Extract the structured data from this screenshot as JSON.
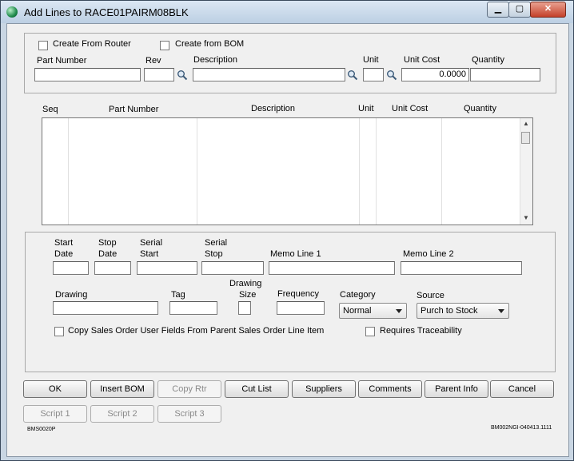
{
  "window": {
    "title": "Add Lines to RACE01PAIRM08BLK",
    "min_glyph": "▁",
    "max_glyph": "▢",
    "close_glyph": "✕"
  },
  "entry": {
    "create_from_router": "Create From Router",
    "create_from_bom": "Create from BOM",
    "part_number_label": "Part Number",
    "rev_label": "Rev",
    "description_label": "Description",
    "unit_label": "Unit",
    "unit_cost_label": "Unit Cost",
    "quantity_label": "Quantity",
    "unit_cost_value": "0.0000"
  },
  "grid": {
    "columns": [
      "Seq",
      "Part Number",
      "Description",
      "Unit",
      "Unit Cost",
      "Quantity"
    ],
    "scroll_up": "▲",
    "scroll_down": "▼"
  },
  "details": {
    "start_date_line1": "Start",
    "start_date_line2": "Date",
    "stop_date_line1": "Stop",
    "stop_date_line2": "Date",
    "serial_start_line1": "Serial",
    "serial_start_line2": "Start",
    "serial_stop_line1": "Serial",
    "serial_stop_line2": "Stop",
    "memo1_label": "Memo Line 1",
    "memo2_label": "Memo Line 2",
    "drawing_label": "Drawing",
    "tag_label": "Tag",
    "drawing_size_line1": "Drawing",
    "drawing_size_line2": "Size",
    "frequency_label": "Frequency",
    "category_label": "Category",
    "category_value": "Normal",
    "source_label": "Source",
    "source_value": "Purch to Stock",
    "copy_fields_label": "Copy Sales Order User Fields From Parent Sales Order Line Item",
    "requires_traceability_label": "Requires Traceability"
  },
  "buttons": {
    "ok": "OK",
    "insert_bom": "Insert BOM",
    "copy_rtr": "Copy Rtr",
    "cut_list": "Cut List",
    "suppliers": "Suppliers",
    "comments": "Comments",
    "parent_info": "Parent Info",
    "cancel": "Cancel",
    "script1": "Script 1",
    "script2": "Script 2",
    "script3": "Script 3"
  },
  "footer": {
    "form_code": "BMS0020P",
    "version_code": "BM002NGI-040413.1111"
  }
}
